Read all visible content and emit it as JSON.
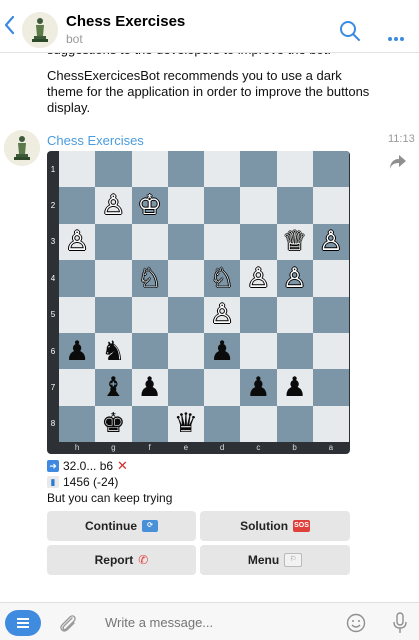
{
  "header": {
    "title": "Chess Exercises",
    "subtitle": "bot"
  },
  "messages": {
    "cut_text": "suggestions to the developers to improve the bot.",
    "recommend_text": "ChessExercicesBot recommends you to use a dark theme for the application in order to improve the buttons display.",
    "sender": "Chess Exercises",
    "time": "11:13"
  },
  "board": {
    "ranks": [
      "1",
      "2",
      "3",
      "4",
      "5",
      "6",
      "7",
      "8"
    ],
    "files": [
      "h",
      "g",
      "f",
      "e",
      "d",
      "c",
      "b",
      "a"
    ],
    "squares": [
      [
        "",
        "",
        "",
        "",
        "",
        "",
        "",
        ""
      ],
      [
        "",
        "♙",
        "♔",
        "",
        "",
        "",
        "",
        ""
      ],
      [
        "♙",
        "",
        "",
        "",
        "",
        "",
        "♕",
        "♙"
      ],
      [
        "",
        "",
        "♘",
        "",
        "♘",
        "♙",
        "♙",
        ""
      ],
      [
        "",
        "",
        "",
        "",
        "♙",
        "",
        "",
        ""
      ],
      [
        "♟",
        "♞",
        "",
        "",
        "♟",
        "",
        "",
        ""
      ],
      [
        "",
        "♝",
        "♟",
        "",
        "",
        "♟",
        "♟",
        ""
      ],
      [
        "",
        "♚",
        "",
        "♛",
        "",
        "",
        "",
        ""
      ]
    ]
  },
  "result": {
    "move": "32.0... b6",
    "rating": "1456 (-24)",
    "note": "But you can keep trying"
  },
  "buttons": {
    "continue": "Continue",
    "solution": "Solution",
    "report": "Report",
    "menu": "Menu",
    "continue_emoji": "🔁",
    "solution_emoji": "SOS",
    "report_emoji": "📞"
  },
  "input": {
    "placeholder": "Write a message..."
  },
  "icons": [
    "back-icon",
    "bot-avatar-icon",
    "search-icon",
    "more-icon",
    "share-icon",
    "menu-icon",
    "attach-icon",
    "emoji-icon",
    "mic-icon"
  ],
  "colors": {
    "accent": "#3f8be0",
    "light_square": "#e7eaec",
    "dark_square": "#7c95a7",
    "board_frame": "#2d3136"
  }
}
